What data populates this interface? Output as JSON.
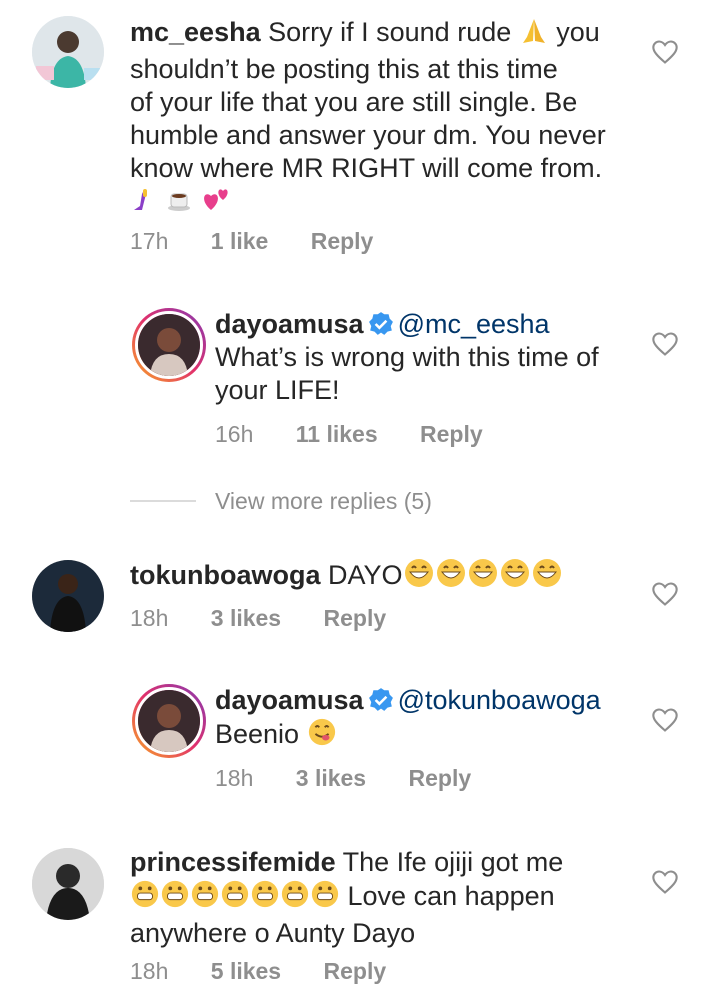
{
  "comments": [
    {
      "username": "mc_eesha",
      "text_line1": "Sorry if I sound rude",
      "text_line1_after": "you",
      "text_line2": "shouldn’t be posting this at this time",
      "text_line3": "of your life that you are still single. Be",
      "text_line4": "humble and answer your dm. You never",
      "text_line5": "know where MR RIGHT will come from.",
      "time": "17h",
      "likes": "1 like",
      "reply": "Reply"
    },
    {
      "username": "dayoamusa",
      "mention": "@mc_eesha",
      "text_line1": "What’s is wrong with this time of",
      "text_line2": "your LIFE!",
      "time": "16h",
      "likes": "11 likes",
      "reply": "Reply"
    },
    {
      "view_more": "View more replies (5)"
    },
    {
      "username": "tokunboawoga",
      "text": "DAYO",
      "time": "18h",
      "likes": "3 likes",
      "reply": "Reply"
    },
    {
      "username": "dayoamusa",
      "mention": "@tokunboawoga",
      "text": "Beenio",
      "time": "18h",
      "likes": "3 likes",
      "reply": "Reply"
    },
    {
      "username": "princessifemide",
      "text_line1": "The Ife ojiji got me",
      "text_line2_after": "Love can happen",
      "text_line3": "anywhere o Aunty Dayo",
      "time": "18h",
      "likes": "5 likes",
      "reply": "Reply"
    }
  ],
  "colors": {
    "text": "#262626",
    "meta": "#8e8e8e",
    "mention": "#003569",
    "verified": "#3897f0"
  },
  "icons": [
    "heart-icon",
    "verified-badge-icon",
    "pray-emoji",
    "grin-emoji",
    "smile-emoji",
    "savoring-emoji"
  ]
}
